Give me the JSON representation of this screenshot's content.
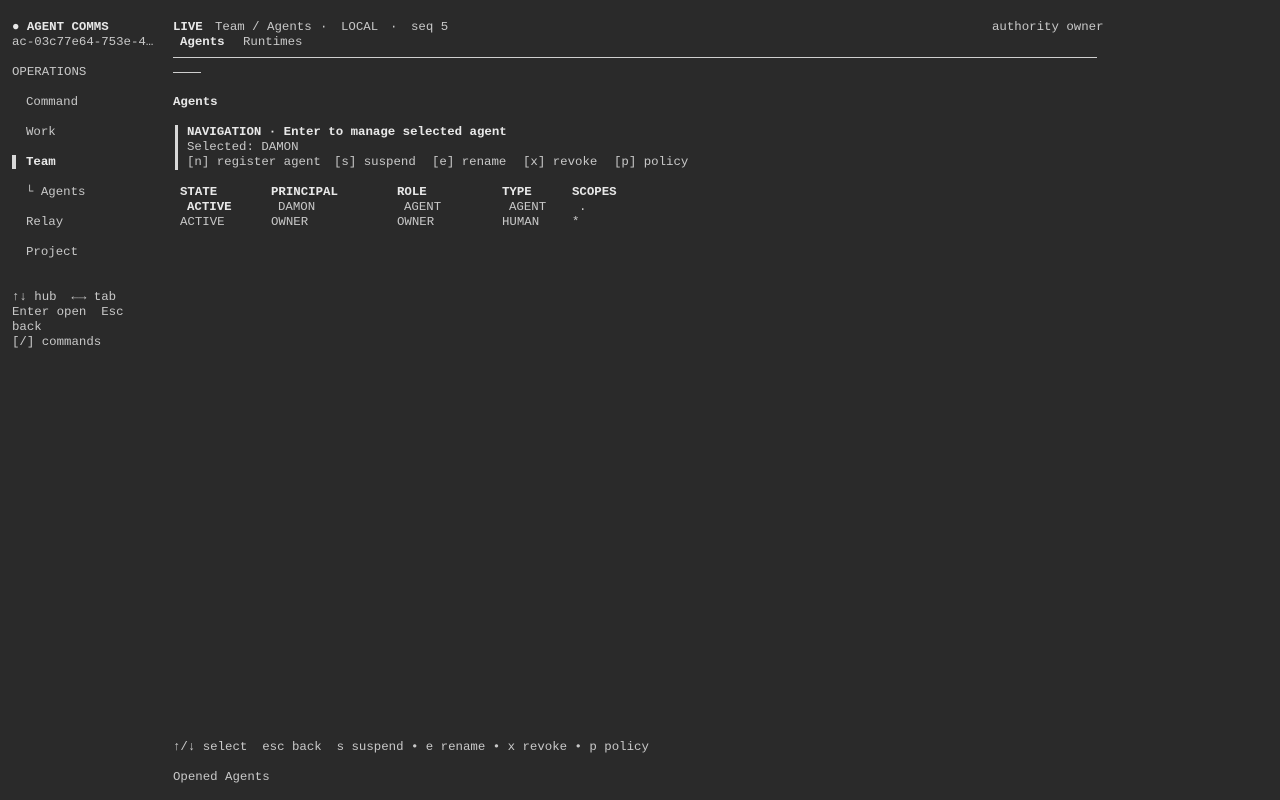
{
  "sidebar": {
    "app_title": "● AGENT COMMS",
    "session_id": "ac-03c77e64-753e-4…",
    "section_label": "OPERATIONS",
    "items": [
      {
        "label": "Command"
      },
      {
        "label": "Work"
      },
      {
        "label": "Team"
      },
      {
        "label": "└ Agents"
      },
      {
        "label": "Relay"
      },
      {
        "label": "Project"
      }
    ],
    "hints": [
      "↑↓ hub  ←→ tab",
      "Enter open  Esc",
      "back",
      "[/] commands"
    ]
  },
  "header": {
    "status": "LIVE",
    "breadcrumb": "Team / Agents",
    "sep1": "·",
    "scope": "LOCAL",
    "sep2": "·",
    "seq": "seq 5",
    "authority": "authority owner",
    "tabs": [
      {
        "label": "Agents"
      },
      {
        "label": "Runtimes"
      }
    ]
  },
  "main": {
    "section_title": "Agents",
    "nav_box": {
      "title": "NAVIGATION · Enter to manage selected agent",
      "selected": "Selected: DAMON",
      "actions": [
        "[n] register agent",
        "[s] suspend",
        "[e] rename",
        "[x] revoke",
        "[p] policy"
      ]
    },
    "table": {
      "headers": [
        "STATE",
        "PRINCIPAL",
        "ROLE",
        "TYPE",
        "SCOPES"
      ],
      "rows": [
        [
          "ACTIVE",
          "DAMON",
          "AGENT",
          "AGENT",
          "."
        ],
        [
          "ACTIVE",
          "OWNER",
          "OWNER",
          "HUMAN",
          "*"
        ]
      ]
    }
  },
  "footer": {
    "keys": "↑/↓ select  esc back  s suspend • e rename • x revoke • p policy",
    "status": "Opened Agents"
  }
}
